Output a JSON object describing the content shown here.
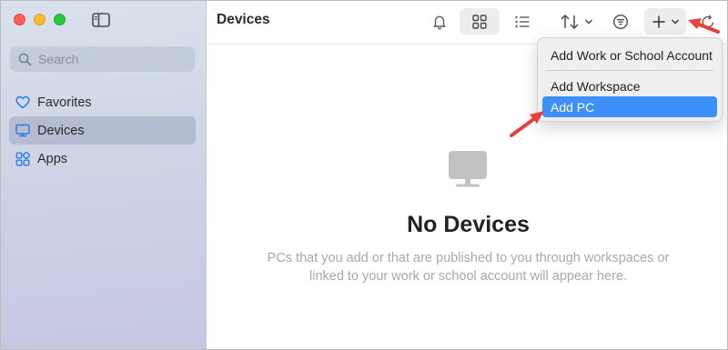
{
  "sidebar": {
    "search_placeholder": "Search",
    "items": [
      {
        "label": "Favorites",
        "icon": "heart-icon",
        "active": false
      },
      {
        "label": "Devices",
        "icon": "monitor-icon",
        "active": true
      },
      {
        "label": "Apps",
        "icon": "apps-grid-icon",
        "active": false
      }
    ]
  },
  "toolbar": {
    "title": "Devices",
    "buttons": [
      "bell-icon",
      "grid-view-icon",
      "list-view-icon",
      "sort-icon",
      "filter-icon",
      "add-icon",
      "refresh-icon"
    ]
  },
  "empty_state": {
    "icon": "monitor-icon",
    "title": "No Devices",
    "description": "PCs that you add or that are published to you through workspaces or linked to your work or school account will appear here."
  },
  "add_menu": {
    "items": [
      {
        "label": "Add Work or School Account",
        "highlighted": false
      },
      {
        "label": "Add Workspace",
        "highlighted": false
      },
      {
        "label": "Add PC",
        "highlighted": true
      }
    ]
  },
  "colors": {
    "accent": "#3d90f7",
    "annotation_arrow": "#e8403a",
    "sidebar_icon": "#2f7de1"
  }
}
